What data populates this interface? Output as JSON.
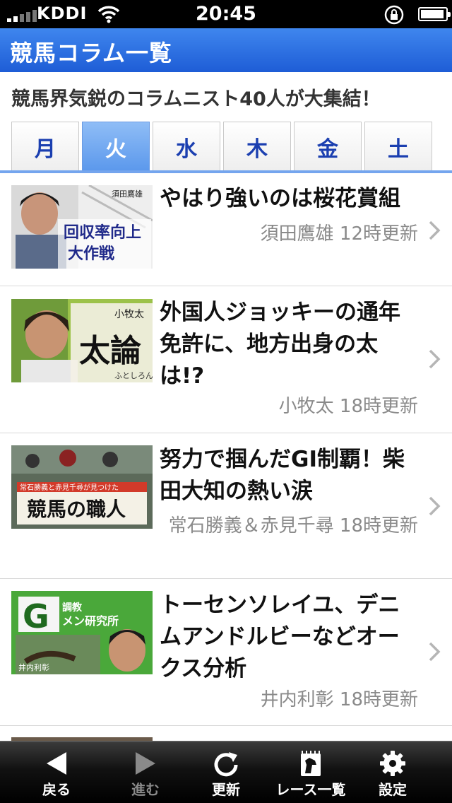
{
  "status_bar": {
    "carrier": "KDDI",
    "time": "20:45"
  },
  "nav": {
    "title": "競馬コラム一覧"
  },
  "subtitle": "競馬界気鋭のコラムニスト40人が大集結！",
  "day_tabs": [
    {
      "label": "月"
    },
    {
      "label": "火",
      "active": true
    },
    {
      "label": "水"
    },
    {
      "label": "木"
    },
    {
      "label": "金"
    },
    {
      "label": "土"
    }
  ],
  "columns": [
    {
      "title": "やはり強いのは桜花賞組",
      "meta": "須田鷹雄 12時更新",
      "thumb": {
        "text1": "回収率向上",
        "text2": "大作戦",
        "name": "須田鷹雄"
      }
    },
    {
      "title": "外国人ジョッキーの通年免許に、地方出身の太は!?",
      "meta": "小牧太 18時更新",
      "thumb": {
        "text1": "太論",
        "name": "小牧太",
        "sub": "ふとしろん"
      }
    },
    {
      "title": "努力で掴んだGI制覇！柴田大知の熱い涙",
      "meta": "常石勝義＆赤見千尋 18時更新",
      "thumb": {
        "text1": "競馬の職人",
        "banner": "常石勝義と赤見千尋が見つけた"
      }
    },
    {
      "title": "トーセンソレイユ、デニムアンドルビーなどオークス分析",
      "meta": "井内利彰 18時更新",
      "thumb": {
        "text1": "G",
        "text2": "調教",
        "text3": "メン研究所",
        "name": "井内利彰"
      }
    }
  ],
  "tabbar": {
    "items": [
      {
        "label": "戻る",
        "icon": "back-arrow-icon"
      },
      {
        "label": "進む",
        "icon": "forward-arrow-icon",
        "disabled": true
      },
      {
        "label": "更新",
        "icon": "refresh-icon"
      },
      {
        "label": "レース一覧",
        "icon": "race-list-icon"
      },
      {
        "label": "設定",
        "icon": "gear-icon"
      }
    ]
  }
}
